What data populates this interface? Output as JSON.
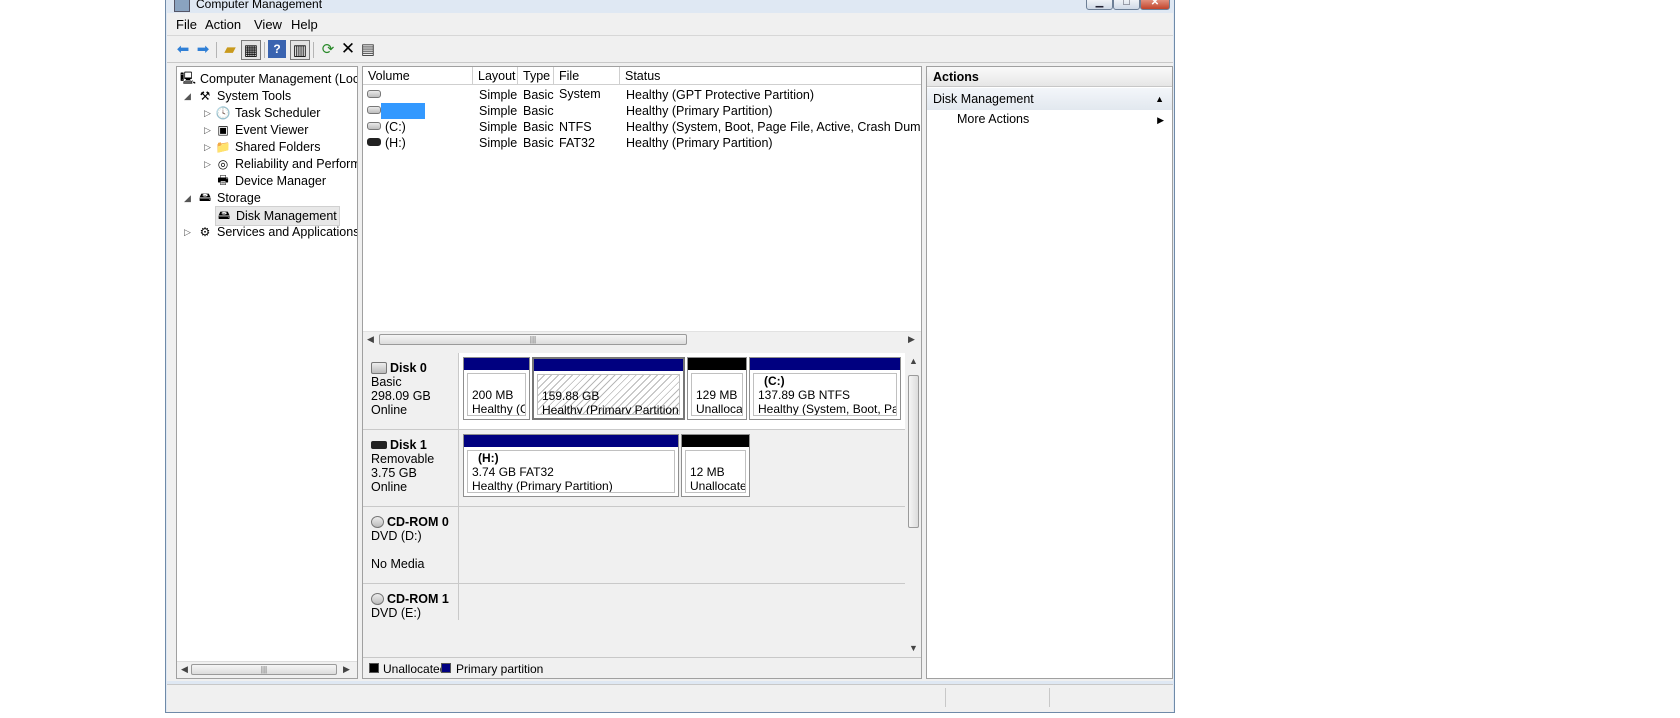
{
  "window": {
    "title": "Computer Management"
  },
  "menu": [
    "File",
    "Action",
    "View",
    "Help"
  ],
  "toolbar": {
    "icons": [
      "back-arrow-icon",
      "forward-arrow-icon",
      "up-folder-icon",
      "show-hide-tree-icon",
      "help-icon",
      "show-hide-action-pane-icon",
      "refresh-icon",
      "delete-icon",
      "properties-icon"
    ]
  },
  "tree": {
    "root": "Computer Management (Local)",
    "system_tools": "System Tools",
    "task_scheduler": "Task Scheduler",
    "event_viewer": "Event Viewer",
    "shared_folders": "Shared Folders",
    "reliability": "Reliability and Performance",
    "device_manager": "Device Manager",
    "storage": "Storage",
    "disk_management": "Disk Management",
    "services": "Services and Applications"
  },
  "volumes": {
    "columns": [
      "Volume",
      "Layout",
      "Type",
      "File System",
      "Status"
    ],
    "rows": [
      {
        "volume": "",
        "layout": "Simple",
        "type": "Basic",
        "fs": "",
        "status": "Healthy (GPT Protective Partition)"
      },
      {
        "volume": "",
        "layout": "Simple",
        "type": "Basic",
        "fs": "",
        "status": "Healthy (Primary Partition)"
      },
      {
        "volume": "(C:)",
        "layout": "Simple",
        "type": "Basic",
        "fs": "NTFS",
        "status": "Healthy (System, Boot, Page File, Active, Crash Dump, Primary Partition)"
      },
      {
        "volume": "(H:)",
        "layout": "Simple",
        "type": "Basic",
        "fs": "FAT32",
        "status": "Healthy (Primary Partition)"
      }
    ]
  },
  "disks": {
    "disk0": {
      "name": "Disk 0",
      "type": "Basic",
      "size": "298.09 GB",
      "state": "Online",
      "p1": {
        "size": "200 MB",
        "status": "Healthy (GPT Protective Partition)"
      },
      "p2": {
        "size": "159.88 GB",
        "status": "Healthy (Primary Partition)"
      },
      "p3": {
        "size": "129 MB",
        "status": "Unallocated"
      },
      "p4": {
        "label": "(C:)",
        "size": "137.89 GB NTFS",
        "status": "Healthy (System, Boot, Page File, Active, Crash Dump, Primary Partition)"
      }
    },
    "disk1": {
      "name": "Disk 1",
      "type": "Removable",
      "size": "3.75 GB",
      "state": "Online",
      "p1": {
        "label": "(H:)",
        "size": "3.74 GB FAT32",
        "status": "Healthy (Primary Partition)"
      },
      "p2": {
        "size": "12 MB",
        "status": "Unallocated"
      }
    },
    "cdrom0": {
      "name": "CD-ROM 0",
      "type": "DVD (D:)",
      "state": "No Media"
    },
    "cdrom1": {
      "name": "CD-ROM 1",
      "type": "DVD (E:)"
    }
  },
  "legend": {
    "unallocated": "Unallocated",
    "primary": "Primary partition"
  },
  "actions": {
    "header": "Actions",
    "section": "Disk Management",
    "more": "More Actions"
  },
  "colors": {
    "primary": "#000080",
    "unallocated": "#000000",
    "highlight": "#3399ff"
  }
}
